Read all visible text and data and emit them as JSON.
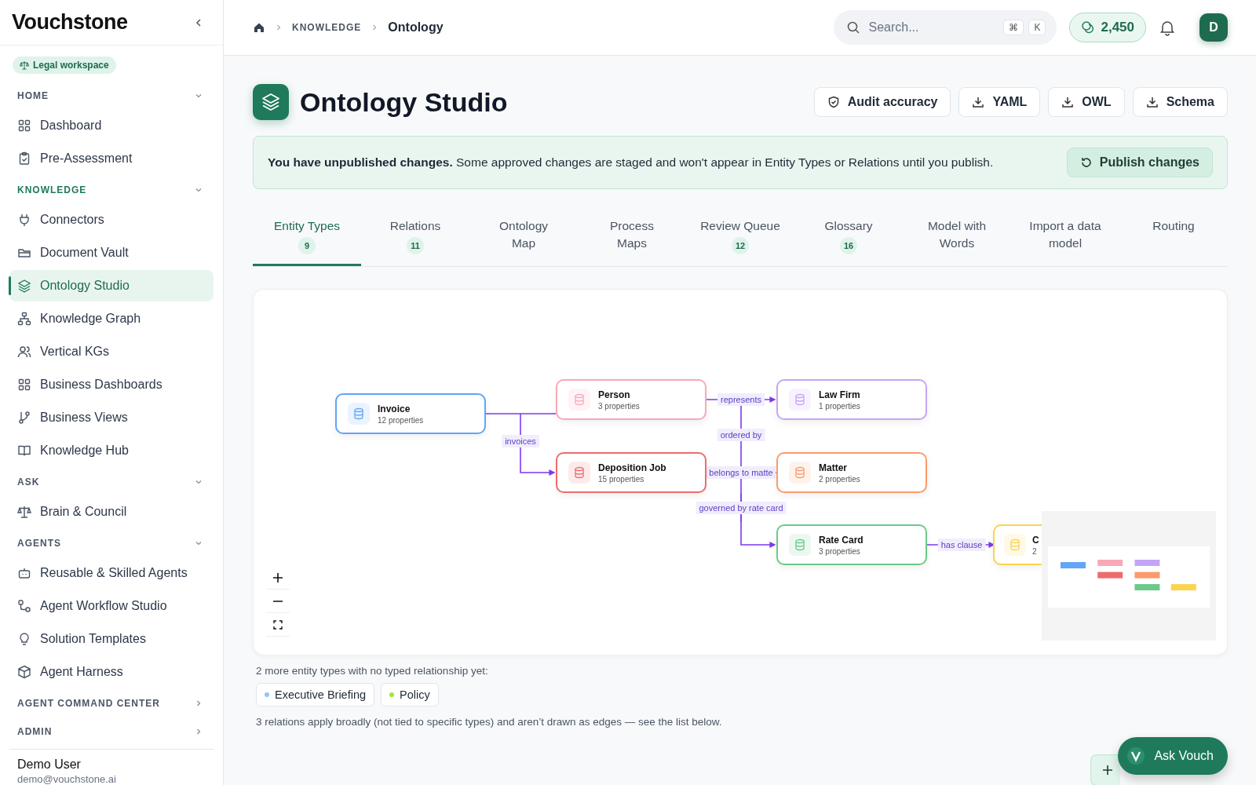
{
  "sidebar": {
    "logo": "Vouchstone",
    "workspace_badge": "Legal workspace",
    "sections": [
      {
        "label": "HOME",
        "expanded": true,
        "active": false,
        "items": [
          {
            "label": "Dashboard",
            "selected": false
          },
          {
            "label": "Pre-Assessment",
            "selected": false
          }
        ]
      },
      {
        "label": "KNOWLEDGE",
        "expanded": true,
        "active": true,
        "items": [
          {
            "label": "Connectors",
            "selected": false
          },
          {
            "label": "Document Vault",
            "selected": false
          },
          {
            "label": "Ontology Studio",
            "selected": true
          },
          {
            "label": "Knowledge Graph",
            "selected": false
          },
          {
            "label": "Vertical KGs",
            "selected": false
          },
          {
            "label": "Business Dashboards",
            "selected": false
          },
          {
            "label": "Business Views",
            "selected": false
          },
          {
            "label": "Knowledge Hub",
            "selected": false
          }
        ]
      },
      {
        "label": "ASK",
        "expanded": true,
        "active": false,
        "items": [
          {
            "label": "Brain & Council",
            "selected": false
          }
        ]
      },
      {
        "label": "AGENTS",
        "expanded": true,
        "active": false,
        "items": [
          {
            "label": "Reusable & Skilled Agents",
            "selected": false
          },
          {
            "label": "Agent Workflow Studio",
            "selected": false
          },
          {
            "label": "Solution Templates",
            "selected": false
          },
          {
            "label": "Agent Harness",
            "selected": false
          }
        ]
      },
      {
        "label": "AGENT COMMAND CENTER",
        "expanded": false,
        "active": false
      },
      {
        "label": "ADMIN",
        "expanded": false,
        "active": false
      }
    ],
    "user": {
      "name": "Demo User",
      "email": "demo@vouchstone.ai"
    }
  },
  "topbar": {
    "breadcrumb": [
      "KNOWLEDGE",
      "Ontology"
    ],
    "search": {
      "placeholder": "Search...",
      "shortcut": [
        "⌘",
        "K"
      ]
    },
    "credits": "2,450",
    "avatar": "D"
  },
  "page": {
    "title": "Ontology Studio",
    "actions": [
      {
        "label": "Audit accuracy",
        "kind": "audit"
      },
      {
        "label": "YAML",
        "kind": "export"
      },
      {
        "label": "OWL",
        "kind": "export"
      },
      {
        "label": "Schema",
        "kind": "export"
      }
    ]
  },
  "banner": {
    "text": "**You have unpublished changes.** Some approved changes are staged and won't appear in Entity Types or Relations until you publish.",
    "button": "Publish changes"
  },
  "tabs": [
    {
      "label": "Entity Types",
      "count": "9",
      "selected": true
    },
    {
      "label": "Relations",
      "count": "11",
      "selected": false
    },
    {
      "label": "Ontology Map",
      "selected": false
    },
    {
      "label": "Process Maps",
      "selected": false
    },
    {
      "label": "Review Queue",
      "count": "12",
      "selected": false
    },
    {
      "label": "Glossary",
      "count": "16",
      "selected": false
    },
    {
      "label": "Model with Words",
      "selected": false
    },
    {
      "label": "Import a data model",
      "selected": false
    },
    {
      "label": "Routing",
      "selected": false
    }
  ],
  "graph": {
    "nodes": [
      {
        "name": "Invoice",
        "properties": "12 properties",
        "color": "#60a5fa"
      },
      {
        "name": "Person",
        "properties": "3 properties",
        "color": "#f9a8b8"
      },
      {
        "name": "Law Firm",
        "properties": "1 properties",
        "color": "#c4a5f5"
      },
      {
        "name": "Deposition Job",
        "properties": "15 properties",
        "color": "#ef6b6b"
      },
      {
        "name": "Matter",
        "properties": "2 properties",
        "color": "#fb9a6a"
      },
      {
        "name": "Rate Card",
        "properties": "3 properties",
        "color": "#6cc98a"
      },
      {
        "name": "C",
        "properties": "2",
        "color": "#fcd34d"
      }
    ],
    "edges": [
      {
        "label": "invoices"
      },
      {
        "label": "represents"
      },
      {
        "label": "ordered by"
      },
      {
        "label": "belongs to matte"
      },
      {
        "label": "governed by rate card"
      },
      {
        "label": "has clause"
      }
    ]
  },
  "untyped": {
    "note": "2 more entity types with no typed relationship yet:",
    "chips": [
      {
        "label": "Executive Briefing",
        "color": "#93c5fd"
      },
      {
        "label": "Policy",
        "color": "#a3e635"
      }
    ]
  },
  "broad_note": "3 relations apply broadly (not tied to specific types) and aren’t drawn as edges — see the list below.",
  "assistant_button": "Ask Vouch"
}
